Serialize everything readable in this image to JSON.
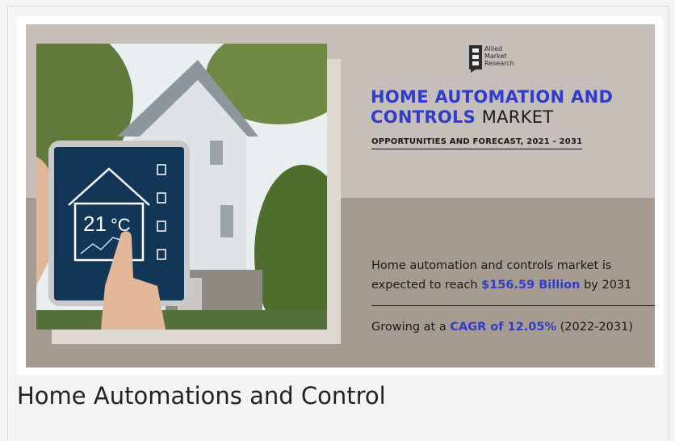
{
  "banner": {
    "logo": {
      "line1": "Allied",
      "line2": "Market",
      "line3": "Research"
    },
    "title_highlight": "HOME AUTOMATION AND CONTROLS",
    "title_plain": "MARKET",
    "subtitle": "OPPORTUNITIES AND FORECAST, 2021 - 2031",
    "stat1": {
      "before": "Home automation and controls market is expected to reach",
      "value": "$156.59 Billion",
      "after": "by 2031"
    },
    "stat2": {
      "before": "Growing at a",
      "value": "CAGR of 12.05%",
      "after": "(2022-2031)"
    },
    "tablet": {
      "temperature": "21",
      "unit": "°C"
    }
  },
  "caption": "Home Automations and Control",
  "colors": {
    "accent": "#2f3ccc",
    "band_top": "#c6bfb9",
    "band_bottom": "#a69b90"
  }
}
